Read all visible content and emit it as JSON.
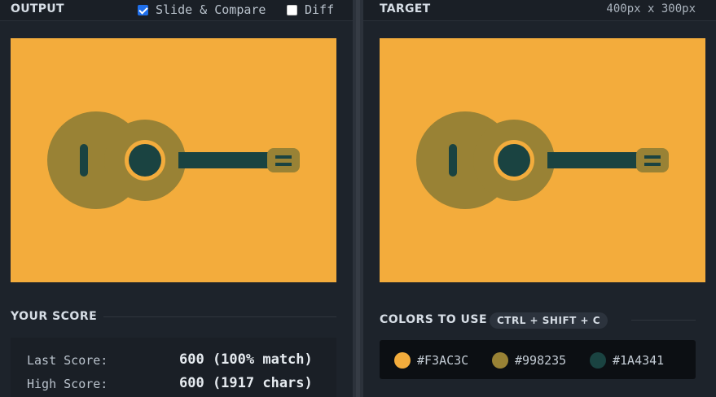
{
  "output": {
    "title": "OUTPUT",
    "slide_compare_label": "Slide & Compare",
    "slide_compare_checked": true,
    "diff_label": "Diff",
    "diff_checked": false
  },
  "target": {
    "title": "TARGET",
    "dimensions": "400px x 300px"
  },
  "score": {
    "title": "YOUR SCORE",
    "last_label": "Last Score:",
    "last_value": "600 (100% match)",
    "high_label": "High Score:",
    "high_value": "600 (1917 chars)"
  },
  "colors": {
    "title": "COLORS TO USE",
    "shortcut": "CTRL + SHIFT + C",
    "swatches": [
      {
        "hex": "#F3AC3C",
        "label": "#F3AC3C"
      },
      {
        "hex": "#998235",
        "label": "#998235"
      },
      {
        "hex": "#1A4341",
        "label": "#1A4341"
      }
    ]
  }
}
